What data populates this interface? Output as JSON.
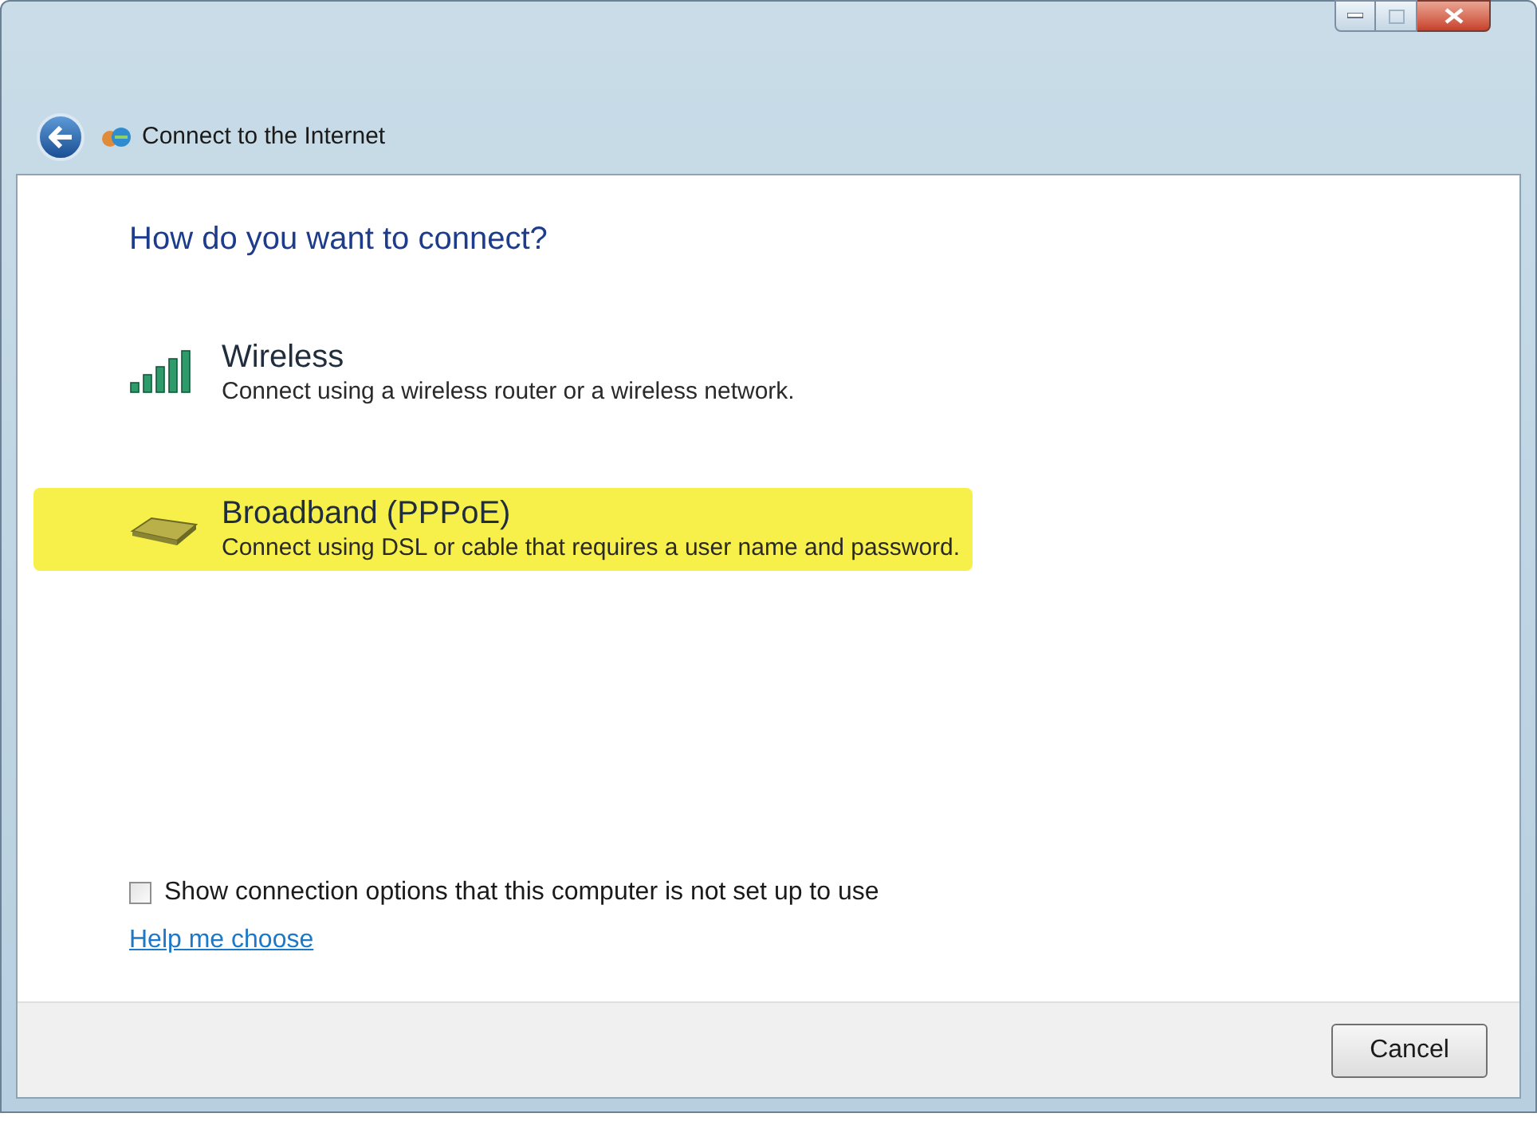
{
  "window": {
    "title": "Connect to the Internet"
  },
  "heading": "How do you want to connect?",
  "options": [
    {
      "kind": "wireless",
      "title": "Wireless",
      "description": "Connect using a wireless router or a wireless network.",
      "highlighted": false
    },
    {
      "kind": "broadband",
      "title": "Broadband (PPPoE)",
      "description": "Connect using DSL or cable that requires a user name and password.",
      "highlighted": true
    }
  ],
  "show_options": {
    "label": "Show connection options that this computer is not set up to use",
    "checked": false
  },
  "help_link": "Help me choose",
  "buttons": [
    "Cancel"
  ]
}
